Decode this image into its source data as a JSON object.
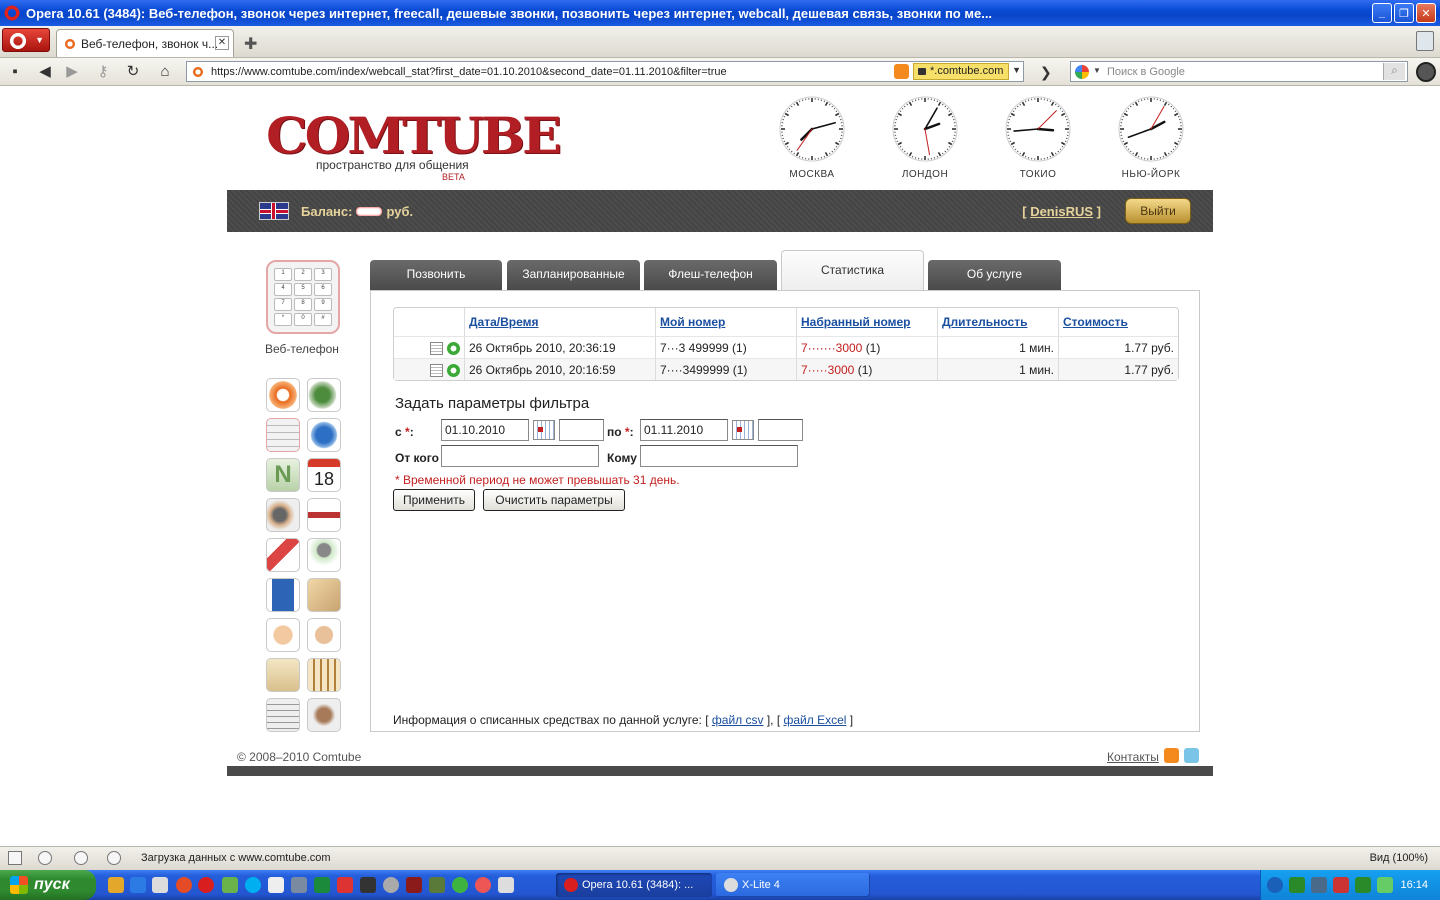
{
  "window": {
    "title": "Opera 10.61 (3484): Веб-телефон, звонок через интернет, freecall, дешевые звонки, позвонить через интернет, webcall, дешевая связь, звонки по ме..."
  },
  "browser": {
    "tab_label": "Веб-телефон, звонок ч...",
    "url": "https://www.comtube.com/index/webcall_stat?first_date=01.10.2010&second_date=01.11.2010&filter=true",
    "secure_domain": "*.comtube.com",
    "search_placeholder": "Поиск в Google",
    "status_message": "Загрузка данных с www.comtube.com",
    "zoom_label": "Вид (100%)"
  },
  "site": {
    "logo_text": "COMTUBE",
    "tagline": "пространство для общения",
    "beta": "BETA",
    "clocks": [
      {
        "city": "МОСКВА",
        "hour_angle": 225,
        "minute_angle": 75
      },
      {
        "city": "ЛОНДОН",
        "hour_angle": 70,
        "minute_angle": 30
      },
      {
        "city": "ТОКИО",
        "hour_angle": 95,
        "minute_angle": 265
      },
      {
        "city": "НЬЮ-ЙОРК",
        "hour_angle": 62,
        "minute_angle": 250
      }
    ],
    "balance_label": "Баланс:",
    "balance_currency": "руб.",
    "user_name": "DenisRUS",
    "logout_label": "Выйти",
    "webphone_label": "Веб-телефон",
    "tabs": [
      {
        "label": "Позвонить"
      },
      {
        "label": "Запланированные"
      },
      {
        "label": "Флеш-телефон"
      },
      {
        "label": "Статистика"
      },
      {
        "label": "Об услуге"
      }
    ],
    "table": {
      "headers": [
        "Дата/Время",
        "Мой номер",
        "Набранный номер",
        "Длительность",
        "Стоимость"
      ],
      "rows": [
        {
          "datetime": "26 Октябрь 2010, 20:36:19",
          "my_number": "7···3 499999 (1)",
          "dialed_prefix": "7·······3000",
          "dialed_suffix": "(1)",
          "duration": "1 мин.",
          "cost": "1.77 руб."
        },
        {
          "datetime": "26 Октябрь 2010, 20:16:59",
          "my_number": "7····3499999 (1)",
          "dialed_prefix": "7·····3000",
          "dialed_suffix": "(1)",
          "duration": "1 мин.",
          "cost": "1.77 руб."
        }
      ]
    },
    "filter": {
      "title": "Задать параметры фильтра",
      "from_label": "с",
      "to_label": "по",
      "from_date": "01.10.2010",
      "to_date": "01.11.2010",
      "sender_label": "От кого",
      "receiver_label": "Кому",
      "warning": "* Временной период не может превышать 31 день.",
      "apply_label": "Применить",
      "clear_label": "Очистить параметры"
    },
    "info_text": "Информация о списанных средствах по данной услуге:",
    "csv_link": "файл csv",
    "excel_link": "файл Excel",
    "copyright": "© 2008–2010 Comtube",
    "contacts": "Контакты"
  },
  "taskbar": {
    "start_label": "пуск",
    "tasks": [
      "Opera 10.61 (3484): ...",
      "X-Lite 4"
    ],
    "time": "16:14"
  }
}
